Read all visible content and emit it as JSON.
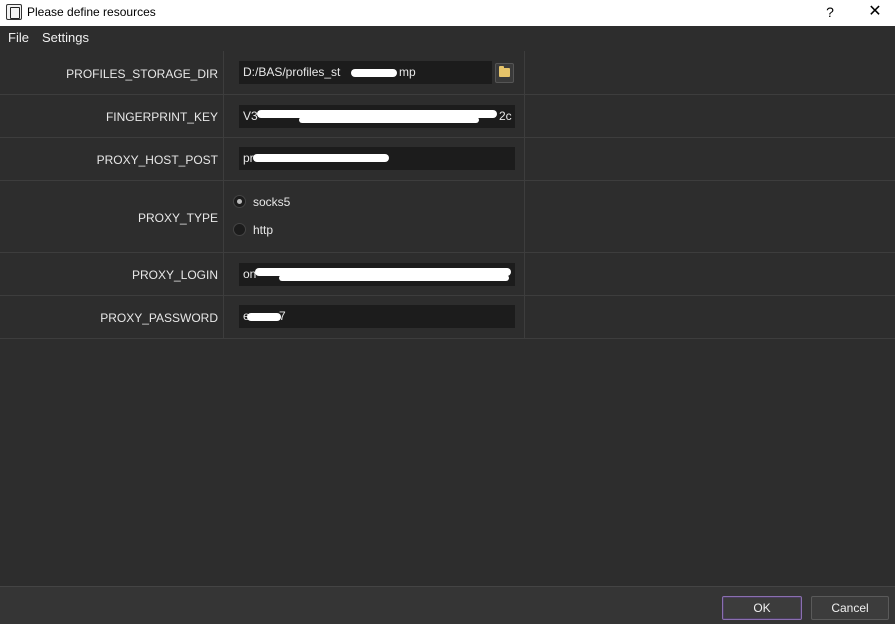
{
  "window": {
    "title": "Please define resources",
    "help_label": "?",
    "close_label": "✕"
  },
  "menu": {
    "items": [
      "File",
      "Settings"
    ]
  },
  "form": {
    "profiles_storage_dir": {
      "label": "PROFILES_STORAGE_DIR",
      "value": "D:/BAS/profiles_st",
      "value_tail": "mp"
    },
    "fingerprint_key": {
      "label": "FINGERPRINT_KEY",
      "value": "V3",
      "value_tail": "2c"
    },
    "proxy_host_post": {
      "label": "PROXY_HOST_POST",
      "value": "pr",
      "value_tail": ""
    },
    "proxy_type": {
      "label": "PROXY_TYPE",
      "options": [
        {
          "label": "socks5",
          "selected": true
        },
        {
          "label": "http",
          "selected": false
        }
      ]
    },
    "proxy_login": {
      "label": "PROXY_LOGIN",
      "value": "on",
      "value_tail": ""
    },
    "proxy_password": {
      "label": "PROXY_PASSWORD",
      "value": "e",
      "value_tail": "7"
    }
  },
  "footer": {
    "ok_label": "OK",
    "cancel_label": "Cancel"
  },
  "colors": {
    "background": "#2d2d2d",
    "field_background": "#1c1c1c",
    "ok_border_accent": "#8a6fb0"
  }
}
